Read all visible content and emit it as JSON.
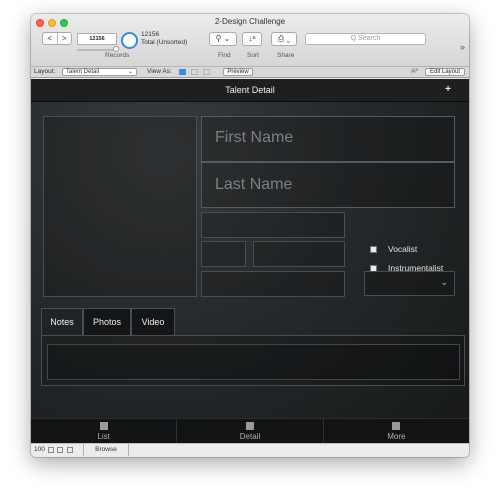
{
  "window": {
    "title": "2-Design Challenge"
  },
  "toolbar": {
    "nav_prev": "<",
    "nav_next": ">",
    "record_number": "12156",
    "records_label": "Records",
    "total_count": "12156",
    "total_status": "Total (Unsorted)",
    "find_icon": "⚲ ⌄",
    "sort_icon": "↓ᵃ",
    "share_icon": "⎙ ⌄",
    "find_label": "Find",
    "sort_label": "Sort",
    "share_label": "Share",
    "search_placeholder": "Q Search",
    "overflow": "»"
  },
  "layoutbar": {
    "layout_label": "Layout:",
    "layout_value": "Talent Detail",
    "view_as_label": "View As:",
    "preview_label": "Preview",
    "text_size_label": "Aª",
    "edit_layout_label": "Edit Layout"
  },
  "header": {
    "title": "Talent Detail",
    "add": "+"
  },
  "form": {
    "first_name_placeholder": "First Name",
    "last_name_placeholder": "Last Name",
    "checkboxes": [
      {
        "label": "Vocalist",
        "checked": false
      },
      {
        "label": "Instrumentalist",
        "checked": false
      }
    ],
    "dropdown_chevron": "⌄"
  },
  "tabs": [
    {
      "label": "Notes",
      "active": true
    },
    {
      "label": "Photos",
      "active": false
    },
    {
      "label": "Video",
      "active": false
    }
  ],
  "bottom_nav": [
    {
      "label": "List"
    },
    {
      "label": "Detail"
    },
    {
      "label": "More"
    }
  ],
  "statusbar": {
    "zoom": "100",
    "mode": "Browse"
  },
  "colors": {
    "content_bg": "#26292b",
    "header_bg": "#1d1f20",
    "accent_blue": "#3d8de0"
  }
}
